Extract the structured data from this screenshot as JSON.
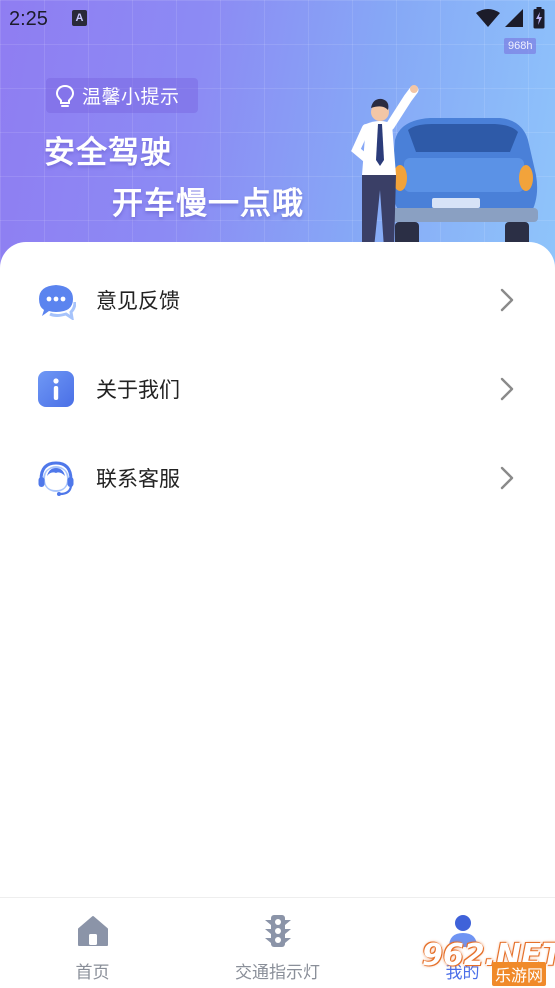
{
  "status_bar": {
    "time": "2:25",
    "notification_glyph": "A",
    "speed": "968h"
  },
  "banner": {
    "tip_label": "温馨小提示",
    "slogan_line1": "安全驾驶",
    "slogan_line2": "开车慢一点哦"
  },
  "menu": {
    "items": [
      {
        "label": "意见反馈",
        "icon": "chat-bubble-icon"
      },
      {
        "label": "关于我们",
        "icon": "info-icon"
      },
      {
        "label": "联系客服",
        "icon": "customer-service-icon"
      }
    ]
  },
  "bottom_nav": {
    "items": [
      {
        "label": "首页",
        "icon": "home-icon"
      },
      {
        "label": "交通指示灯",
        "icon": "traffic-light-icon"
      },
      {
        "label": "我的",
        "icon": "profile-icon"
      }
    ],
    "active_index": 2
  },
  "watermark": {
    "main": "962.NET",
    "sub": "乐游网"
  },
  "colors": {
    "accent": "#4b6fe8",
    "banner_start": "#8f7df2",
    "banner_end": "#8fc5fb",
    "nav_inactive": "#8a8f99"
  }
}
